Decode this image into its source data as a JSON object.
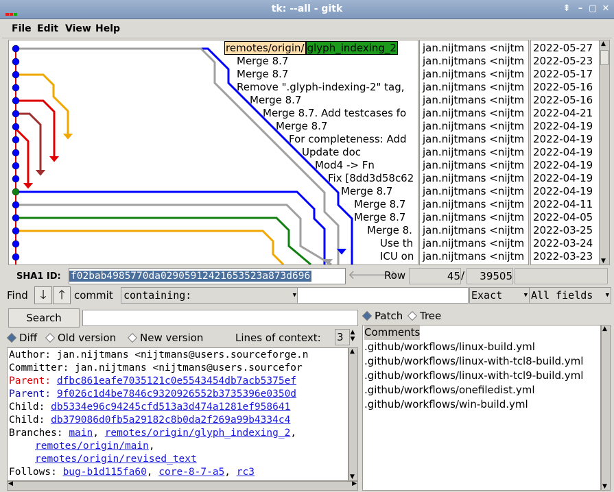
{
  "window": {
    "title": "tk: --all - gitk"
  },
  "menu": [
    "File",
    "Edit",
    "View",
    "Help"
  ],
  "commits": [
    {
      "subject": "",
      "author": "jan.nijtmans <nijtm",
      "date": "2022-05-27"
    },
    {
      "subject": "Merge 8.7",
      "author": "jan.nijtmans <nijtm",
      "date": "2022-05-23"
    },
    {
      "subject": "Merge 8.7",
      "author": "jan.nijtmans <nijtm",
      "date": "2022-05-17"
    },
    {
      "subject": "Remove \".glyph-indexing-2\" tag,",
      "author": "jan.nijtmans <nijtm",
      "date": "2022-05-16"
    },
    {
      "subject": "Merge 8.7",
      "author": "jan.nijtmans <nijtm",
      "date": "2022-05-16"
    },
    {
      "subject": "Merge 8.7. Add testcases fo",
      "author": "jan.nijtmans <nijtm",
      "date": "2022-04-21"
    },
    {
      "subject": "Merge 8.7",
      "author": "jan.nijtmans <nijtm",
      "date": "2022-04-19"
    },
    {
      "subject": "For completeness: Add",
      "author": "jan.nijtmans <nijtm",
      "date": "2022-04-19"
    },
    {
      "subject": "Update doc",
      "author": "jan.nijtmans <nijtm",
      "date": "2022-04-19"
    },
    {
      "subject": "Mod4 -> Fn",
      "author": "jan.nijtmans <nijtm",
      "date": "2022-04-19"
    },
    {
      "subject": "Fix [8dd3d58c62",
      "author": "jan.nijtmans <nijtm",
      "date": "2022-04-19"
    },
    {
      "subject": "Merge 8.7",
      "author": "jan.nijtmans <nijtm",
      "date": "2022-04-19"
    },
    {
      "subject": "Merge 8.7",
      "author": "jan.nijtmans <nijtm",
      "date": "2022-04-11"
    },
    {
      "subject": "Merge 8.7",
      "author": "jan.nijtmans <nijtm",
      "date": "2022-04-05"
    },
    {
      "subject": "Merge 8.",
      "author": "jan.nijtmans <nijtm",
      "date": "2022-03-25"
    },
    {
      "subject": "Use th",
      "author": "jan.nijtmans <nijtm",
      "date": "2022-03-24"
    },
    {
      "subject": "ICU on",
      "author": "jan.nijtmans <nijtm",
      "date": "2022-03-23"
    }
  ],
  "tags": {
    "remote": "remotes/origin/",
    "branch": "glyph_indexing_2"
  },
  "sha": {
    "label": "SHA1 ID:",
    "value": "f02bab4985770da02905912421653523a873d696"
  },
  "nav": {
    "row_label": "Row",
    "row": "45",
    "slash": "/",
    "total": "39505"
  },
  "find": {
    "label": "Find",
    "commit_label": "commit",
    "mode": "containing:",
    "match": "Exact",
    "fields": "All fields"
  },
  "search": {
    "button": "Search"
  },
  "diff_opts": {
    "diff": "Diff",
    "old": "Old version",
    "new": "New version",
    "ctx_label": "Lines of context:",
    "ctx_value": "3"
  },
  "details": {
    "author": "Author: jan.nijtmans <nijtmans@users.sourceforge.n",
    "committer": "Committer: jan.nijtmans <nijtmans@users.sourcefor",
    "parent_label": "Parent:",
    "parent1": "dfbc861eafe7035121c0e5543454db7acb5375ef",
    "parent2": "9f026c1d4be7846c9320926552b3735396e0350d",
    "child_label": "Child:",
    "child1": "db5334e96c94245cfd513a3d474a1281ef958641",
    "child2": "db379086d0fb5a29182c8b0da2f269a99b4334c4",
    "branches_label": "Branches:",
    "branch1": "main",
    "branch2": "remotes/origin/glyph_indexing_2",
    "branch3": "remotes/origin/main",
    "branch4": "remotes/origin/revised_text",
    "follows_label": "Follows:",
    "follow1": "bug-b1d115fa60",
    "follow2": "core-8-7-a5",
    "follow3": "rc3",
    "comma": ","
  },
  "view": {
    "patch": "Patch",
    "tree": "Tree"
  },
  "files": [
    "Comments",
    ".github/workflows/linux-build.yml",
    ".github/workflows/linux-with-tcl8-build.yml",
    ".github/workflows/linux-with-tcl9-build.yml",
    ".github/workflows/onefiledist.yml",
    ".github/workflows/win-build.yml"
  ],
  "colors": {
    "selection": "#4a6f9c",
    "branch_tag": "#1b9a1b",
    "remote_tag": "#ffddaa",
    "graph_main": "#0000ff",
    "graph_gray": "#a0a0a0",
    "graph_orange": "#f0a800",
    "graph_red": "#e00000",
    "graph_brown": "#a03030",
    "graph_green": "#108010"
  }
}
